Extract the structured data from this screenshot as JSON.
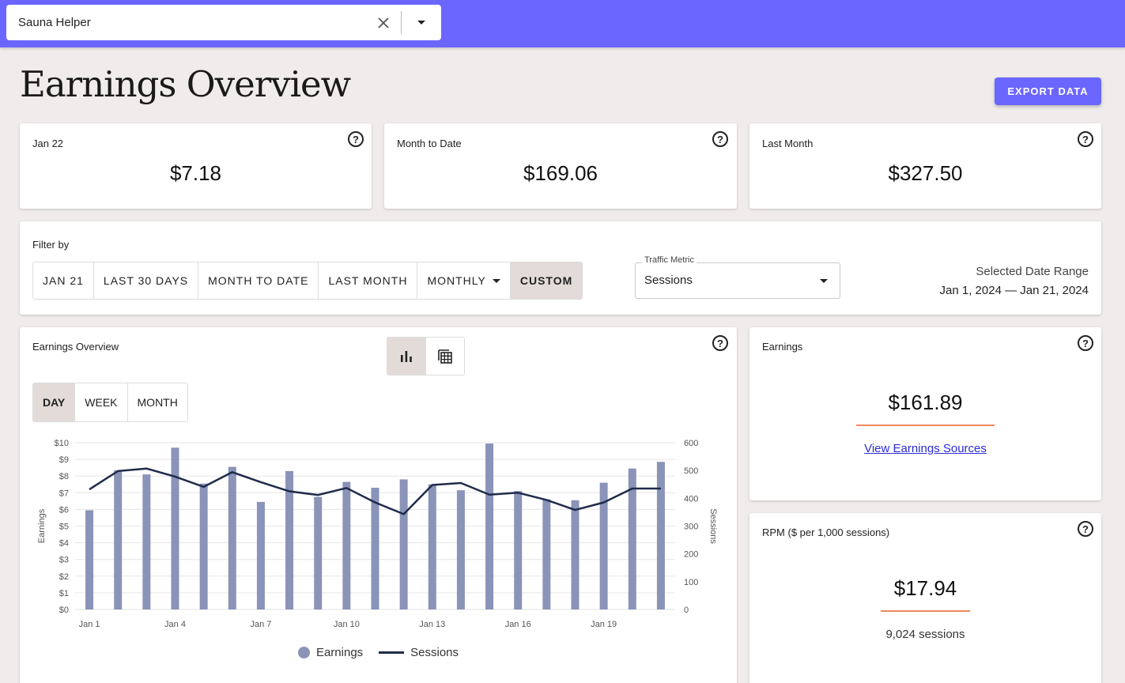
{
  "header": {
    "site_name": "Sauna Helper"
  },
  "page": {
    "title": "Earnings Overview",
    "export_label": "EXPORT DATA"
  },
  "summary": [
    {
      "label": "Jan 22",
      "value": "$7.18"
    },
    {
      "label": "Month to Date",
      "value": "$169.06"
    },
    {
      "label": "Last Month",
      "value": "$327.50"
    }
  ],
  "filter": {
    "label": "Filter by",
    "options": [
      "JAN 21",
      "LAST 30 DAYS",
      "MONTH TO DATE",
      "LAST MONTH",
      "MONTHLY",
      "CUSTOM"
    ],
    "active": "CUSTOM",
    "traffic_metric_label": "Traffic Metric",
    "traffic_metric_value": "Sessions",
    "range_title": "Selected Date Range",
    "range_value": "Jan 1, 2024 — Jan 21, 2024"
  },
  "overview": {
    "title": "Earnings Overview",
    "view_icons": [
      "bar-chart-icon",
      "table-icon"
    ],
    "periods": [
      "DAY",
      "WEEK",
      "MONTH"
    ],
    "active_period": "DAY"
  },
  "chart_data": {
    "type": "bar",
    "x": [
      "Jan 1",
      "Jan 2",
      "Jan 3",
      "Jan 4",
      "Jan 5",
      "Jan 6",
      "Jan 7",
      "Jan 8",
      "Jan 9",
      "Jan 10",
      "Jan 11",
      "Jan 12",
      "Jan 13",
      "Jan 14",
      "Jan 15",
      "Jan 16",
      "Jan 17",
      "Jan 18",
      "Jan 19",
      "Jan 20",
      "Jan 21"
    ],
    "tick_labels": [
      "Jan 1",
      "Jan 4",
      "Jan 7",
      "Jan 10",
      "Jan 13",
      "Jan 16",
      "Jan 19"
    ],
    "series": [
      {
        "name": "Earnings",
        "type": "bar",
        "axis": "left",
        "color": "#8a93b8",
        "values": [
          5.95,
          8.35,
          8.1,
          9.7,
          7.55,
          8.55,
          6.45,
          8.3,
          6.75,
          7.65,
          7.3,
          7.8,
          7.5,
          7.15,
          9.95,
          7.1,
          6.6,
          6.55,
          7.6,
          8.45,
          8.85
        ]
      },
      {
        "name": "Sessions",
        "type": "line",
        "axis": "right",
        "color": "#1f2b4a",
        "values": [
          432,
          498,
          507,
          478,
          441,
          494,
          458,
          425,
          412,
          437,
          385,
          343,
          448,
          455,
          413,
          420,
          394,
          358,
          385,
          435,
          435
        ]
      }
    ],
    "ylabel": "Earnings",
    "ylim": [
      0,
      10
    ],
    "y_ticks": [
      "$0",
      "$1",
      "$2",
      "$3",
      "$4",
      "$5",
      "$6",
      "$7",
      "$8",
      "$9",
      "$10"
    ],
    "y2label": "Sessions",
    "y2lim": [
      0,
      600
    ],
    "y2_ticks": [
      "0",
      "100",
      "200",
      "300",
      "400",
      "500",
      "600"
    ],
    "grid": true,
    "legend": "bottom"
  },
  "earnings_card": {
    "label": "Earnings",
    "value": "$161.89",
    "link": "View Earnings Sources"
  },
  "rpm_card": {
    "label": "RPM ($ per 1,000 sessions)",
    "value": "$17.94",
    "sub": "9,024 sessions"
  },
  "colors": {
    "accent": "#6b66ff",
    "underline": "#ef8a5d",
    "bar": "#8a93b8",
    "line": "#1f2b4a"
  }
}
